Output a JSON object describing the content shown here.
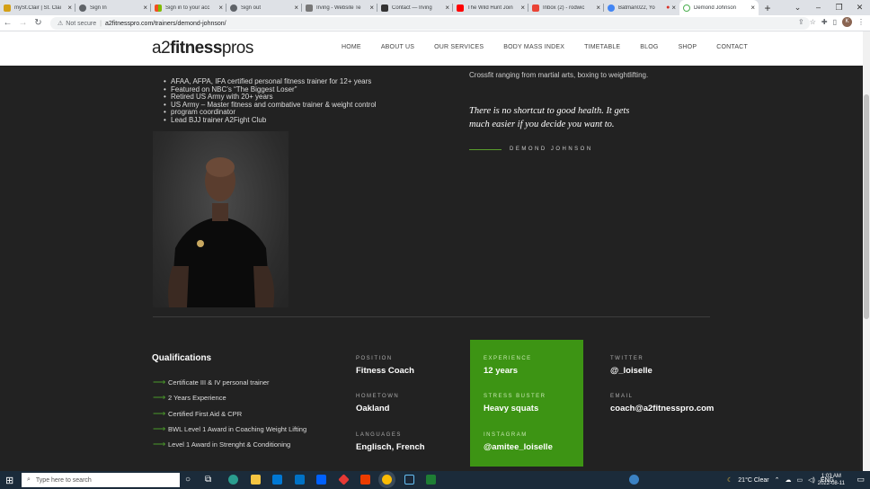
{
  "browser": {
    "tabs": [
      {
        "title": "mySt.Clair | St. Clai",
        "color": "#d4a017"
      },
      {
        "title": "Sign In",
        "color": "#5f6368"
      },
      {
        "title": "Sign in to your acc",
        "color": "#f25022"
      },
      {
        "title": "Sign out",
        "color": "#5f6368"
      },
      {
        "title": "Irving - Website Te",
        "color": "#777777"
      },
      {
        "title": "Contact — Irving",
        "color": "#333333"
      },
      {
        "title": "The Wild Hunt Join",
        "color": "#ff0000"
      },
      {
        "title": "Inbox (2) - rodwic",
        "color": "#ea4335"
      },
      {
        "title": "Batman022, Yo",
        "color": "#4285f4"
      },
      {
        "title": "Demond Johnson",
        "color": "#4caf50"
      }
    ],
    "new_tab": "+",
    "security": "Not secure",
    "url": "a2fitnesspro.com/trainers/demond-johnson/",
    "profile_initial": "K"
  },
  "site": {
    "logo_light": "a2",
    "logo_bold": "fitness",
    "logo_tail": "pros",
    "menu": [
      "HOME",
      "ABOUT US",
      "OUR SERVICES",
      "BODY MASS INDEX",
      "TIMETABLE",
      "BLOG",
      "SHOP",
      "CONTACT"
    ]
  },
  "bio": {
    "bullets": [
      "AFAA, AFPA, IFA certified personal fitness trainer for 12+ years",
      "Featured on NBC’s “The Biggest Loser”",
      "Retired US Army with 20+ years",
      "US Army – Master fitness and combative trainer & weight control",
      "program coordinator",
      "Lead BJJ trainer A2Fight Club"
    ],
    "intro_tail": "Crossfit ranging from martial arts, boxing to weightlifting.",
    "quote": "There is no shortcut to good health. It gets much easier if you decide you want to.",
    "author": "DEMOND JOHNSON"
  },
  "qualifications": {
    "title": "Qualifications",
    "items": [
      "Certificate III & IV personal trainer",
      "2 Years Experience",
      "Certified First Aid & CPR",
      "BWL Level 1 Award in Coaching Weight Lifting",
      "Level 1 Award in Strenght & Conditioning"
    ]
  },
  "details": {
    "position_label": "POSITION",
    "position": "Fitness Coach",
    "hometown_label": "HOMETOWN",
    "hometown": "Oakland",
    "languages_label": "LANGUAGES",
    "languages": "Englisch, French",
    "experience_label": "EXPERIENCE",
    "experience": "12 years",
    "stress_label": "STRESS BUSTER",
    "stress": "Heavy squats",
    "instagram_label": "INSTAGRAM",
    "instagram": "@amitee_loiselle",
    "twitter_label": "TWITTER",
    "twitter": "@_loiselle",
    "email_label": "EMAIL",
    "email": "coach@a2fitnesspro.com"
  },
  "taskbar": {
    "search_placeholder": "Type here to search",
    "weather": "21°C  Clear",
    "lang": "ENG",
    "time": "1:03 AM",
    "date": "2022-08-11"
  }
}
